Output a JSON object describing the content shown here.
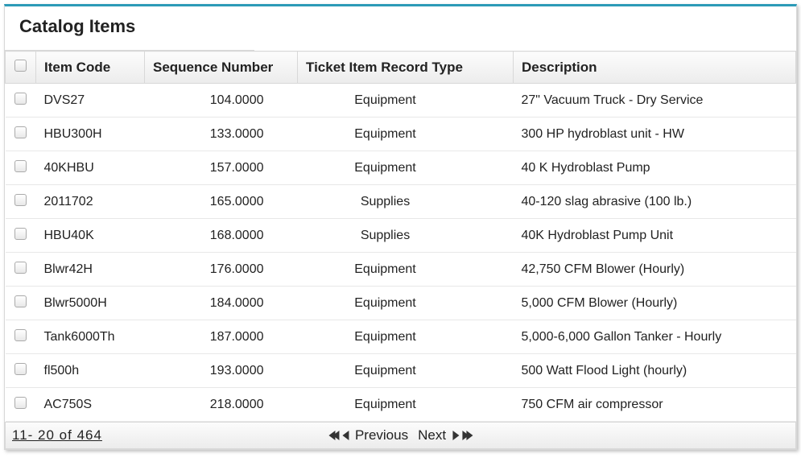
{
  "title": "Catalog Items",
  "columns": {
    "code": "Item Code",
    "seq": "Sequence Number",
    "type": "Ticket Item Record Type",
    "desc": "Description"
  },
  "rows": [
    {
      "code": "DVS27",
      "seq": "104.0000",
      "type": "Equipment",
      "desc": "27\" Vacuum Truck - Dry Service"
    },
    {
      "code": "HBU300H",
      "seq": "133.0000",
      "type": "Equipment",
      "desc": "300 HP hydroblast unit - HW"
    },
    {
      "code": "40KHBU",
      "seq": "157.0000",
      "type": "Equipment",
      "desc": "40 K Hydroblast Pump"
    },
    {
      "code": "2011702",
      "seq": "165.0000",
      "type": "Supplies",
      "desc": "40-120 slag abrasive (100 lb.)"
    },
    {
      "code": "HBU40K",
      "seq": "168.0000",
      "type": "Supplies",
      "desc": "40K Hydroblast Pump Unit"
    },
    {
      "code": "Blwr42H",
      "seq": "176.0000",
      "type": "Equipment",
      "desc": "42,750 CFM Blower (Hourly)"
    },
    {
      "code": "Blwr5000H",
      "seq": "184.0000",
      "type": "Equipment",
      "desc": "5,000 CFM Blower (Hourly)"
    },
    {
      "code": "Tank6000Th",
      "seq": "187.0000",
      "type": "Equipment",
      "desc": "5,000-6,000 Gallon Tanker - Hourly"
    },
    {
      "code": "fl500h",
      "seq": "193.0000",
      "type": "Equipment",
      "desc": "500 Watt Flood Light (hourly)"
    },
    {
      "code": "AC750S",
      "seq": "218.0000",
      "type": "Equipment",
      "desc": "750 CFM air compressor"
    }
  ],
  "pagination": {
    "range": "11- 20  of  464",
    "prev_label": "Previous",
    "next_label": "Next"
  }
}
